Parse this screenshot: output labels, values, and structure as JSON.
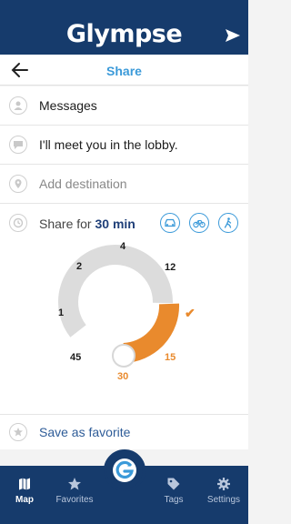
{
  "app": {
    "logo_text": "Glympse"
  },
  "header": {
    "title": "Share"
  },
  "recipient": {
    "label": "Messages"
  },
  "message": {
    "text": "I'll meet you in the lobby."
  },
  "destination": {
    "placeholder": "Add destination"
  },
  "share": {
    "label": "Share for ",
    "duration": "30 min",
    "travel_modes": [
      "car-icon",
      "bike-icon",
      "walk-icon"
    ],
    "dial": {
      "ticks": [
        "4",
        "12",
        "2",
        "1",
        "45",
        "30",
        "15"
      ],
      "selected_minutes": 30,
      "check": "✔"
    }
  },
  "favorite": {
    "label": "Save as favorite"
  },
  "bottom_nav": {
    "items": [
      {
        "label": "Map",
        "icon": "map-icon",
        "active": true
      },
      {
        "label": "Favorites",
        "icon": "star-icon",
        "active": false
      },
      {
        "label": "Tags",
        "icon": "tag-icon",
        "active": false
      },
      {
        "label": "Settings",
        "icon": "gear-icon",
        "active": false
      }
    ]
  },
  "colors": {
    "brand": "#163b6c",
    "accent": "#3b9ad9",
    "orange": "#e98a2d"
  }
}
